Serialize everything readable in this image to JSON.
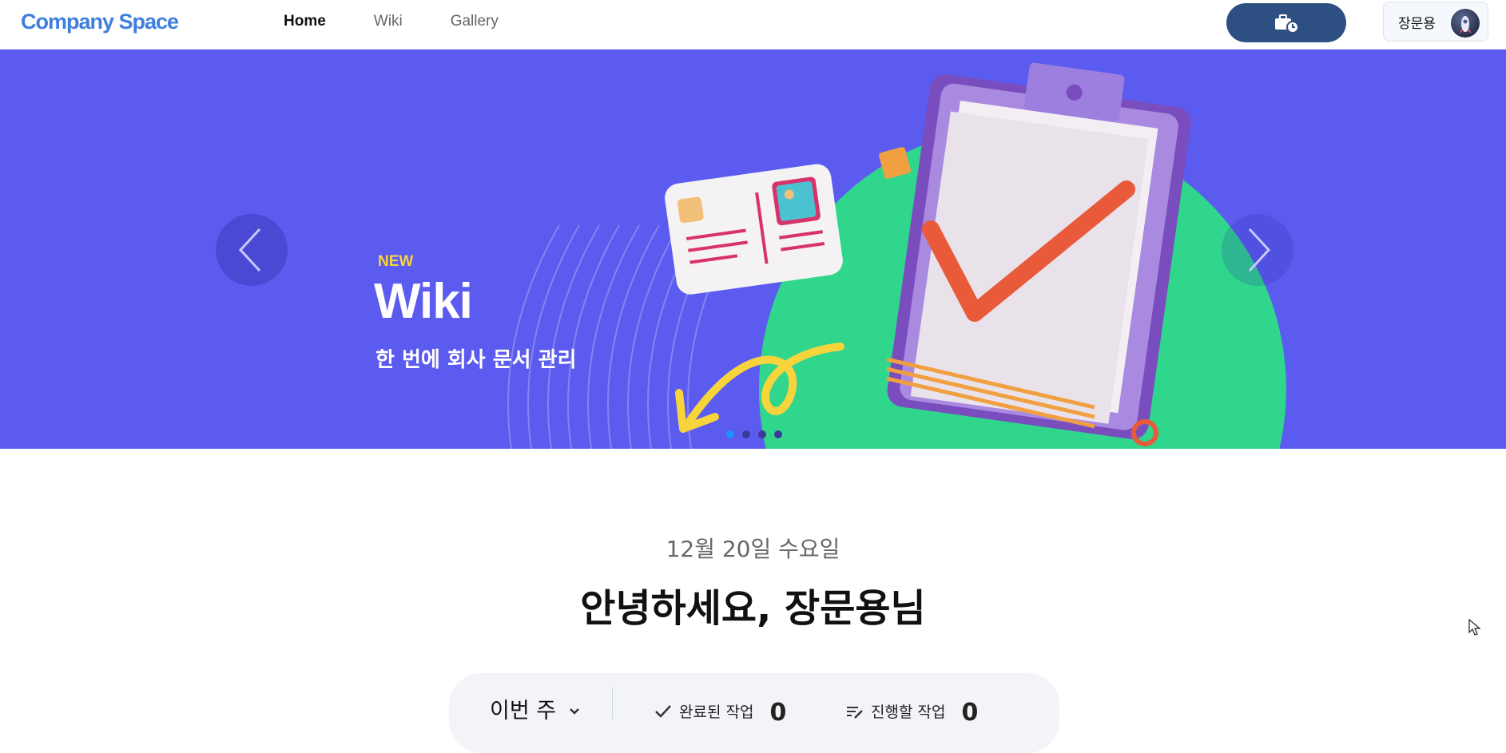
{
  "header": {
    "logo": "Company Space",
    "nav": [
      {
        "label": "Home",
        "active": true
      },
      {
        "label": "Wiki",
        "active": false
      },
      {
        "label": "Gallery",
        "active": false
      }
    ],
    "work_button_icon": "briefcase-clock-icon",
    "profile_name": "장문용",
    "brand_color": "#3f7fdc",
    "work_button_color": "#2d4f82"
  },
  "banner": {
    "badge": "NEW",
    "title": "Wiki",
    "subtitle": "한 번에 회사 문서 관리",
    "background_color": "#5b5bf0",
    "accent_green": "#2fd68c",
    "prev_icon": "chevron-left-icon",
    "next_icon": "chevron-right-icon",
    "slide_count": 4,
    "active_slide": 1
  },
  "main": {
    "date": "12월 20일 수요일",
    "greeting": "안녕하세요, 장문용님",
    "period_select": "이번 주",
    "stats": [
      {
        "label": "완료된 작업",
        "value": "0",
        "icon": "check-icon"
      },
      {
        "label": "진행할 작업",
        "value": "0",
        "icon": "edit-list-icon"
      }
    ]
  }
}
